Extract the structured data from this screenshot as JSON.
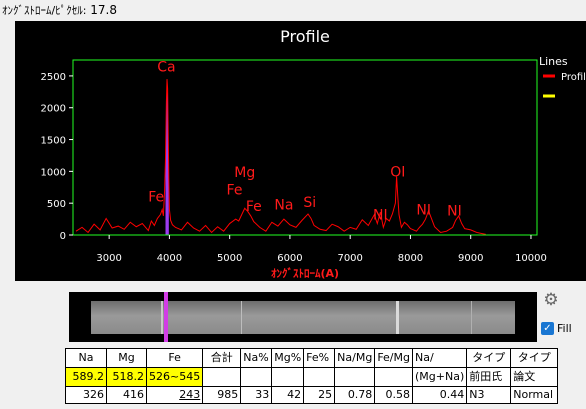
{
  "header": {
    "label": "ｵﾝｸﾞｽﾄﾛｰﾑ/ﾋﾟｸｾﾙ:",
    "value": "17.8"
  },
  "plot": {
    "title": "Profile",
    "legend_title": "Lines",
    "xlabel": "ｵﾝｸﾞｽﾄﾛｰﾑ(A)",
    "colors": {
      "background": "#000000",
      "axes": "#22ff22",
      "profile": "#ff0000",
      "fill": "#9b3cf0",
      "lines": "#ffff00",
      "labels": "#ff1a1a",
      "text": "#ffffff"
    }
  },
  "chart_data": {
    "type": "line",
    "title": "Profile",
    "xlabel": "ｵﾝｸﾞｽﾄﾛｰﾑ(A)",
    "ylabel": "",
    "xlim": [
      2400,
      10100
    ],
    "ylim": [
      0,
      2750
    ],
    "x_ticks": [
      3000,
      4000,
      5000,
      6000,
      7000,
      8000,
      9000,
      10000
    ],
    "y_ticks": [
      0,
      500,
      1000,
      1500,
      2000,
      2500
    ],
    "legend": {
      "title": "Lines",
      "placement": "top-right"
    },
    "series": [
      {
        "name": "Profile",
        "color": "#ff0000",
        "x": [
          2450,
          2550,
          2650,
          2750,
          2850,
          2950,
          3050,
          3150,
          3250,
          3350,
          3450,
          3550,
          3650,
          3700,
          3750,
          3800,
          3850,
          3880,
          3900,
          3920,
          3935,
          3950,
          3960,
          3970,
          3980,
          3990,
          4000,
          4020,
          4050,
          4100,
          4200,
          4300,
          4400,
          4500,
          4600,
          4700,
          4800,
          4900,
          5000,
          5100,
          5150,
          5200,
          5250,
          5300,
          5350,
          5400,
          5500,
          5600,
          5700,
          5800,
          5900,
          6000,
          6100,
          6200,
          6300,
          6350,
          6400,
          6500,
          6600,
          6700,
          6800,
          6900,
          7000,
          7100,
          7200,
          7300,
          7400,
          7450,
          7500,
          7550,
          7600,
          7650,
          7700,
          7750,
          7770,
          7790,
          7810,
          7850,
          7900,
          7950,
          8000,
          8100,
          8150,
          8200,
          8250,
          8300,
          8400,
          8500,
          8600,
          8700,
          8750,
          8800,
          8850,
          8900,
          9000,
          9100,
          9200,
          9250
        ],
        "y": [
          60,
          120,
          40,
          170,
          80,
          260,
          110,
          140,
          90,
          200,
          130,
          180,
          70,
          220,
          150,
          260,
          320,
          400,
          300,
          700,
          1200,
          2100,
          2450,
          2300,
          1600,
          900,
          400,
          230,
          160,
          120,
          80,
          200,
          110,
          60,
          150,
          40,
          130,
          60,
          180,
          250,
          220,
          320,
          420,
          370,
          300,
          210,
          120,
          60,
          200,
          140,
          250,
          160,
          120,
          230,
          330,
          260,
          150,
          90,
          70,
          170,
          130,
          60,
          120,
          90,
          240,
          150,
          320,
          180,
          360,
          120,
          260,
          220,
          330,
          500,
          920,
          600,
          320,
          120,
          200,
          160,
          100,
          60,
          120,
          170,
          250,
          380,
          130,
          40,
          60,
          120,
          230,
          300,
          180,
          100,
          80,
          40,
          20,
          10
        ]
      },
      {
        "name": "",
        "color": "#ffff00",
        "x": [],
        "y": []
      }
    ],
    "annotations": [
      {
        "text": "Ca",
        "x": 3950,
        "y": 2570
      },
      {
        "text": "Fe",
        "x": 3780,
        "y": 530
      },
      {
        "text": "Mg",
        "x": 5250,
        "y": 910
      },
      {
        "text": "Fe",
        "x": 5080,
        "y": 640
      },
      {
        "text": "Fe",
        "x": 5400,
        "y": 380
      },
      {
        "text": "Na",
        "x": 5900,
        "y": 400
      },
      {
        "text": "Si",
        "x": 6330,
        "y": 440
      },
      {
        "text": "NI",
        "x": 7500,
        "y": 240
      },
      {
        "text": "OI",
        "x": 7790,
        "y": 920
      },
      {
        "text": "NI",
        "x": 8220,
        "y": 320
      },
      {
        "text": "NI",
        "x": 8730,
        "y": 310
      }
    ],
    "grid": false
  },
  "strip": {
    "marker_color": "#d23ce6"
  },
  "settings_icon": "gear-icon",
  "fill_toggle": {
    "label": "Fill",
    "checked": true
  },
  "table": {
    "headers": [
      "Na",
      "Mg",
      "Fe",
      "合計",
      "Na%",
      "Mg%",
      "Fe%",
      "Na/Mg",
      "Fe/Mg",
      "Na/",
      "タイプ",
      "タイプ"
    ],
    "row1": [
      "589.2",
      "518.2",
      "526~545",
      "",
      "",
      "",
      "",
      "",
      "",
      "(Mg+Na)",
      "前田氏",
      "論文"
    ],
    "row2": [
      "326",
      "416",
      "243",
      "985",
      "33",
      "42",
      "25",
      "0.78",
      "0.58",
      "0.44",
      "N3",
      "Normal"
    ],
    "highlight_color": "#ffff00"
  }
}
